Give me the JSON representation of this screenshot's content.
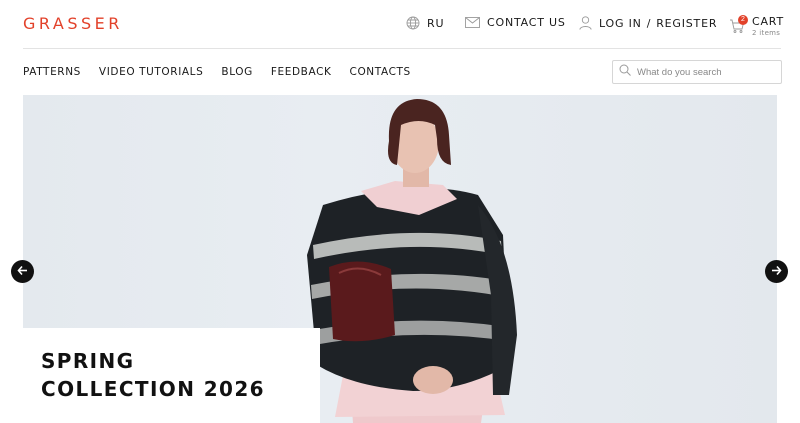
{
  "brand": {
    "logo_text": "GRASSER",
    "accent_color": "#e2412a"
  },
  "header": {
    "language": {
      "label": "RU",
      "icon": "globe-icon"
    },
    "contact": {
      "label": "CONTACT US",
      "icon": "mail-icon"
    },
    "account": {
      "login_label": "LOG IN",
      "separator": "/",
      "register_label": "REGISTER",
      "icon": "user-icon"
    },
    "cart": {
      "label": "CART",
      "count_text": "2 items",
      "badge": "2",
      "icon": "cart-icon"
    }
  },
  "nav": {
    "items": [
      {
        "label": "PATTERNS"
      },
      {
        "label": "VIDEO TUTORIALS"
      },
      {
        "label": "BLOG"
      },
      {
        "label": "FEEDBACK"
      },
      {
        "label": "CONTACTS"
      }
    ]
  },
  "search": {
    "placeholder": "What do you search",
    "value": "",
    "icon": "search-icon"
  },
  "hero": {
    "caption_line1": "SPRING",
    "caption_line2": "COLLECTION 2026",
    "prev_icon": "arrow-left-icon",
    "next_icon": "arrow-right-icon"
  }
}
